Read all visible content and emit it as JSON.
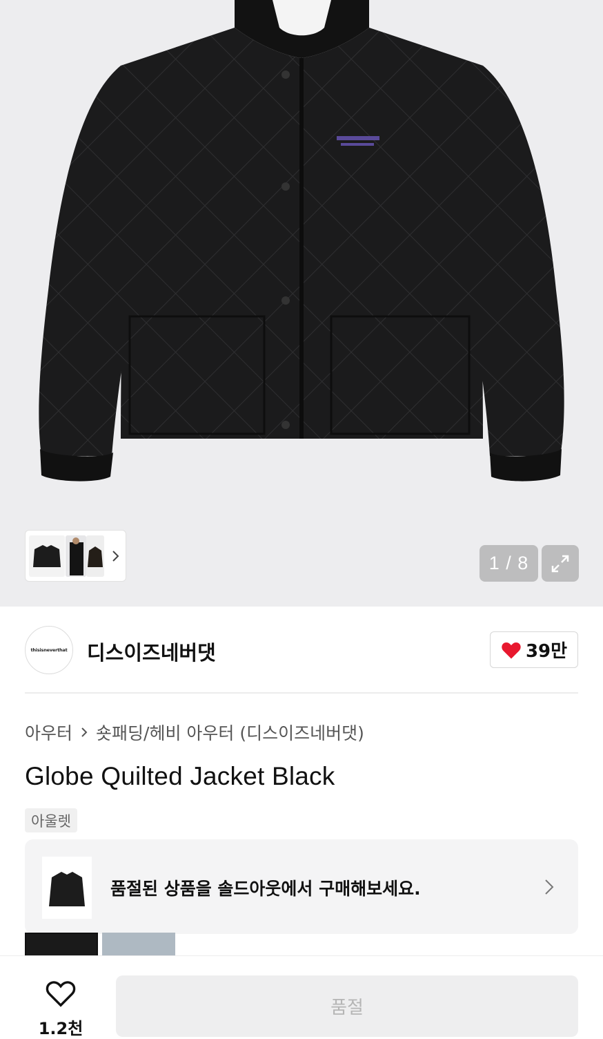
{
  "gallery": {
    "counter": "1 / 8",
    "current": 1,
    "total": 8,
    "icons": {
      "expand": "expand-icon",
      "thumbnail_next": "chevron-right-icon"
    }
  },
  "brand": {
    "logo_text": "thisisneverthat",
    "name": "디스이즈네버댓",
    "like_count": "39만",
    "like_icon": "heart-filled-icon",
    "like_color": "#e8182e"
  },
  "breadcrumb": {
    "items": [
      "아우터",
      "숏패딩/헤비 아우터 (디스이즈네버댓)"
    ]
  },
  "product": {
    "title": "Globe Quilted Jacket Black",
    "tag": "아울렛"
  },
  "soldout_banner": {
    "text": "품절된 상품을 솔드아웃에서 구매해보세요."
  },
  "bottom_bar": {
    "wish_count": "1.2천",
    "buy_label": "품절"
  }
}
